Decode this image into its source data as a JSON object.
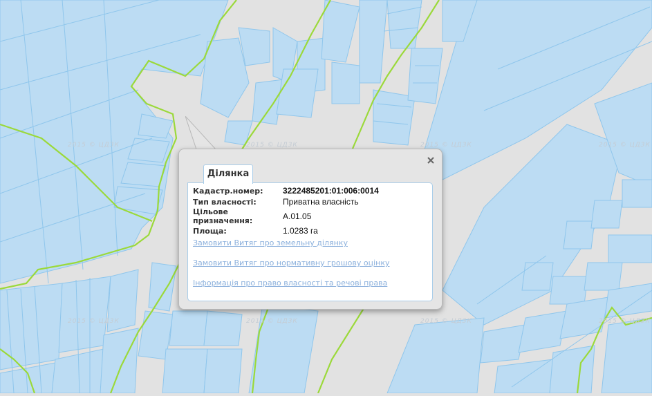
{
  "map": {
    "watermark": "2015 © ЦДЗК",
    "colors": {
      "background": "#e2e2e2",
      "parcel_fill": "#bcdcf3",
      "parcel_stroke": "#8fc6ec",
      "boundary_green": "#9bd93a"
    }
  },
  "popup": {
    "tab_label": "Ділянка",
    "close_icon": "close-icon",
    "fields": [
      {
        "label": "Кадастр.номер:",
        "value": "3222485201:01:006:0014"
      },
      {
        "label": "Тип власності:",
        "value": "Приватна власність"
      },
      {
        "label": "Цільове призначення:",
        "value": "A.01.05"
      },
      {
        "label": "Площа:",
        "value": "1.0283 га"
      }
    ],
    "links": [
      "Замовити Витяг про земельну ділянку",
      "Замовити Витяг про нормативну грошову оцінку",
      "Інформація про право власності та речові права"
    ]
  }
}
